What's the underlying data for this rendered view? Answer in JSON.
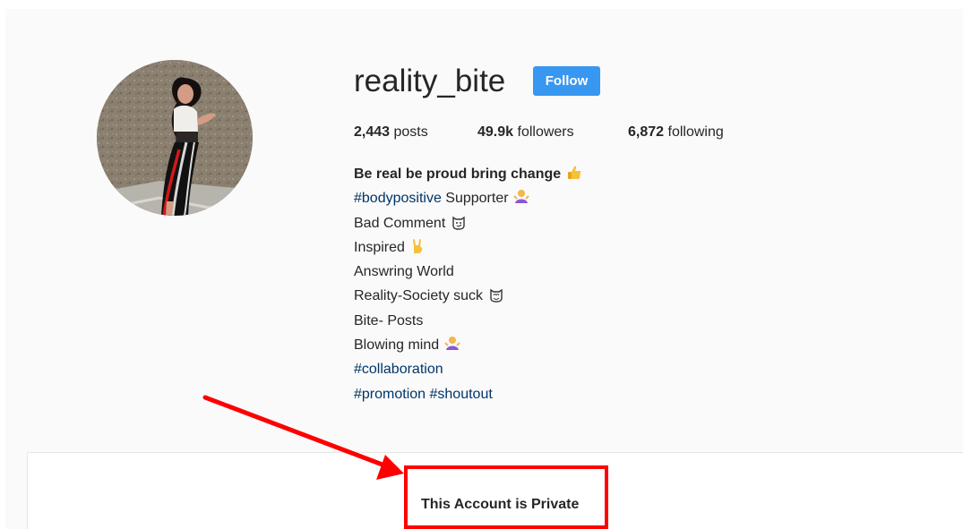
{
  "profile": {
    "username": "reality_bite",
    "follow_label": "Follow",
    "avatar_alt": "profile photo"
  },
  "stats": {
    "posts_count": "2,443",
    "posts_label": " posts",
    "followers_count": "49.9k",
    "followers_label": " followers",
    "following_count": "6,872",
    "following_label": " following"
  },
  "bio": {
    "title": "Be real be proud bring change",
    "line_2_hashtag": "#bodypositive",
    "line_2_text": " Supporter",
    "line_3": "Bad Comment",
    "line_4": "Inspired",
    "line_5": "Answring World",
    "line_6": "Reality-Society suck",
    "line_7": "Bite- Posts",
    "line_8": "Blowing mind",
    "line_9_hashtag": "#collaboration",
    "line_10_hashtag_1": "#promotion",
    "line_10_hashtag_2": "#shoutout"
  },
  "privacy": {
    "message": "This Account is Private"
  },
  "icons": {
    "thumbs_up": "thumbs-up-icon",
    "person_shrugging": "person-shrugging-icon",
    "smirking_cat": "smirking-cat-icon",
    "rock_on_hand": "rock-on-hand-icon",
    "smiling_cat": "smiling-cat-icon"
  },
  "colors": {
    "follow_button": "#3897f0",
    "hashtag": "#003569",
    "text": "#262626",
    "annotation_red": "#ff0000"
  }
}
